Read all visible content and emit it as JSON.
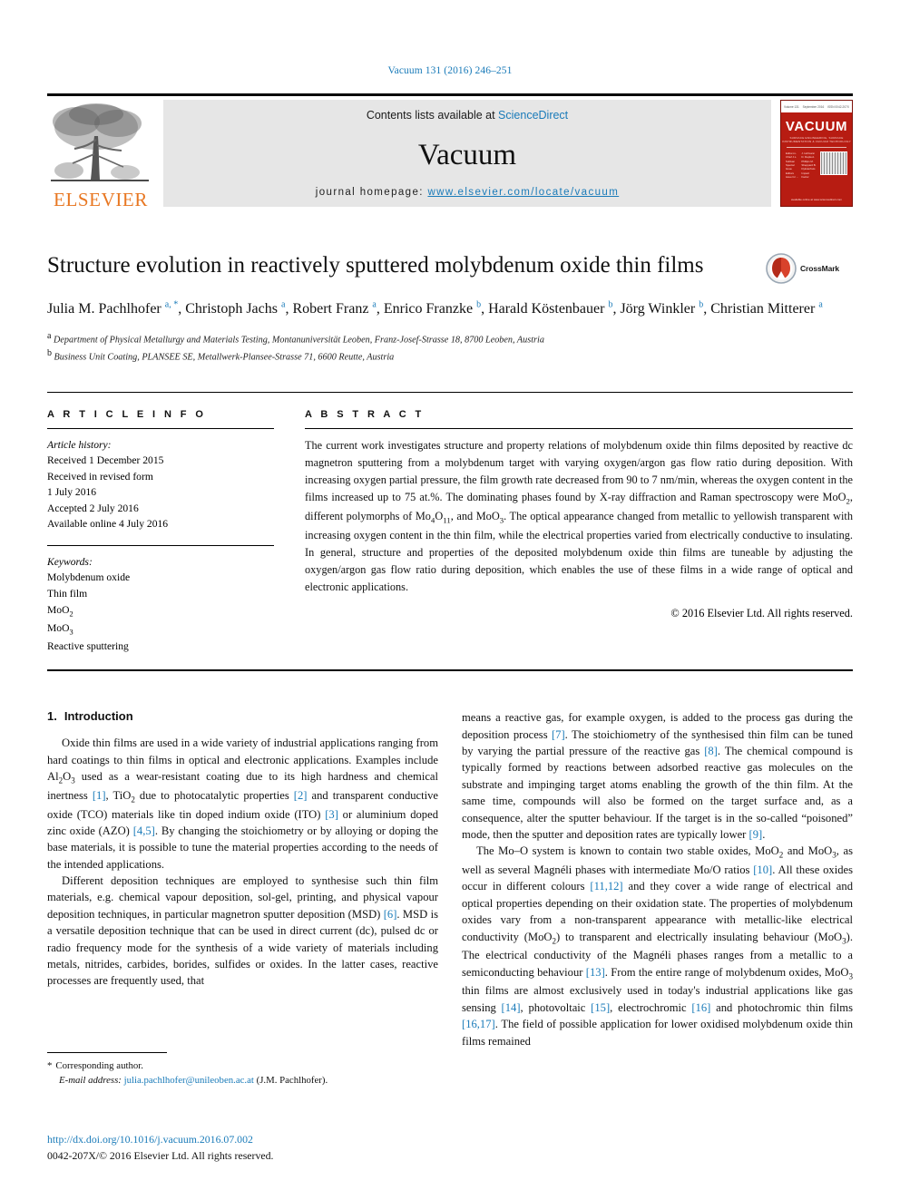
{
  "running_head": "Vacuum 131 (2016) 246–251",
  "masthead": {
    "publisher_name": "ELSEVIER",
    "contents_prefix": "Contents lists available at ",
    "contents_link": "ScienceDirect",
    "journal_name": "Vacuum",
    "homepage_prefix": "journal homepage: ",
    "homepage_url": "www.elsevier.com/locate/vacuum",
    "cover": {
      "title": "VACUUM",
      "subtitle": "SURFACE ENGINEERING, SURFACE INSTRUMENTATION & VACUUM TECHNOLOGY",
      "top_left": "Volume 131",
      "top_mid": "September 2016",
      "top_right": "ISSN 0042-207X",
      "col_a": "Editor-in-Chief\nJ.L. Sullivan\nSpecial Issue Editors\nissue for ...",
      "col_b": "J. Hofmann\nD. Depla\nA. Phillips\nM. Sheppard\nB. Dyksterhuis\nImpact Factor",
      "footer": "available online at www.sciencedirect.com"
    }
  },
  "title": "Structure evolution in reactively sputtered molybdenum oxide thin films",
  "crossmark_label": "CrossMark",
  "authors": [
    {
      "name": "Julia M. Pachlhofer",
      "marks": "a, *"
    },
    {
      "name": "Christoph Jachs",
      "marks": "a"
    },
    {
      "name": "Robert Franz",
      "marks": "a"
    },
    {
      "name": "Enrico Franzke",
      "marks": "b"
    },
    {
      "name": "Harald Köstenbauer",
      "marks": "b"
    },
    {
      "name": "Jörg Winkler",
      "marks": "b"
    },
    {
      "name": "Christian Mitterer",
      "marks": "a"
    }
  ],
  "affiliations": [
    {
      "mark": "a",
      "text": "Department of Physical Metallurgy and Materials Testing, Montanuniversität Leoben, Franz-Josef-Strasse 18, 8700 Leoben, Austria"
    },
    {
      "mark": "b",
      "text": "Business Unit Coating, PLANSEE SE, Metallwerk-Plansee-Strasse 71, 6600 Reutte, Austria"
    }
  ],
  "article_info": {
    "heading": "A R T I C L E  I N F O",
    "history_label": "Article history:",
    "history": [
      "Received 1 December 2015",
      "Received in revised form",
      "1 July 2016",
      "Accepted 2 July 2016",
      "Available online 4 July 2016"
    ],
    "keywords_label": "Keywords:",
    "keywords": [
      "Molybdenum oxide",
      "Thin film",
      "MoO2",
      "MoO3",
      "Reactive sputtering"
    ]
  },
  "abstract": {
    "heading": "A B S T R A C T",
    "text": "The current work investigates structure and property relations of molybdenum oxide thin films deposited by reactive dc magnetron sputtering from a molybdenum target with varying oxygen/argon gas flow ratio during deposition. With increasing oxygen partial pressure, the film growth rate decreased from 90 to 7 nm/min, whereas the oxygen content in the films increased up to 75 at.%. The dominating phases found by X-ray diffraction and Raman spectroscopy were MoO2, different polymorphs of Mo4O11, and MoO3. The optical appearance changed from metallic to yellowish transparent with increasing oxygen content in the thin film, while the electrical properties varied from electrically conductive to insulating. In general, structure and properties of the deposited molybdenum oxide thin films are tuneable by adjusting the oxygen/argon gas flow ratio during deposition, which enables the use of these films in a wide range of optical and electronic applications.",
    "copyright": "© 2016 Elsevier Ltd. All rights reserved."
  },
  "section": {
    "number": "1.",
    "heading": "Introduction"
  },
  "body": {
    "left_p1": "Oxide thin films are used in a wide variety of industrial applications ranging from hard coatings to thin films in optical and electronic applications. Examples include Al2O3 used as a wear-resistant coating due to its high hardness and chemical inertness [1], TiO2 due to photocatalytic properties [2] and transparent conductive oxide (TCO) materials like tin doped indium oxide (ITO) [3] or aluminium doped zinc oxide (AZO) [4,5]. By changing the stoichiometry or by alloying or doping the base materials, it is possible to tune the material properties according to the needs of the intended applications.",
    "left_p2": "Different deposition techniques are employed to synthesise such thin film materials, e.g. chemical vapour deposition, sol-gel, printing, and physical vapour deposition techniques, in particular magnetron sputter deposition (MSD) [6]. MSD is a versatile deposition technique that can be used in direct current (dc), pulsed dc or radio frequency mode for the synthesis of a wide variety of materials including metals, nitrides, carbides, borides, sulfides or oxides. In the latter cases, reactive processes are frequently used, that",
    "right_p1": "means a reactive gas, for example oxygen, is added to the process gas during the deposition process [7]. The stoichiometry of the synthesised thin film can be tuned by varying the partial pressure of the reactive gas [8]. The chemical compound is typically formed by reactions between adsorbed reactive gas molecules on the substrate and impinging target atoms enabling the growth of the thin film. At the same time, compounds will also be formed on the target surface and, as a consequence, alter the sputter behaviour. If the target is in the so-called \"poisoned\" mode, then the sputter and deposition rates are typically lower [9].",
    "right_p2": "The Mo–O system is known to contain two stable oxides, MoO2 and MoO3, as well as several Magnéli phases with intermediate Mo/O ratios [10]. All these oxides occur in different colours [11,12] and they cover a wide range of electrical and optical properties depending on their oxidation state. The properties of molybdenum oxides vary from a non-transparent appearance with metallic-like electrical conductivity (MoO2) to transparent and electrically insulating behaviour (MoO3). The electrical conductivity of the Magnéli phases ranges from a metallic to a semiconducting behaviour [13]. From the entire range of molybdenum oxides, MoO3 thin films are almost exclusively used in today's industrial applications like gas sensing [14], photovoltaic [15], electrochromic [16] and photochromic thin films [16,17]. The field of possible application for lower oxidised molybdenum oxide thin films remained"
  },
  "footnote": {
    "star": "*",
    "corresponding": "Corresponding author.",
    "email_label": "E-mail address:",
    "email": "julia.pachlhofer@unileoben.ac.at",
    "email_suffix": "(J.M. Pachlhofer)."
  },
  "doi": "http://dx.doi.org/10.1016/j.vacuum.2016.07.002",
  "issn_line": "0042-207X/© 2016 Elsevier Ltd. All rights reserved.",
  "colors": {
    "link": "#1a7bb9",
    "elsevier_orange": "#E87722",
    "cover_red": "#b71c12",
    "band_gray": "#e6e6e6"
  }
}
